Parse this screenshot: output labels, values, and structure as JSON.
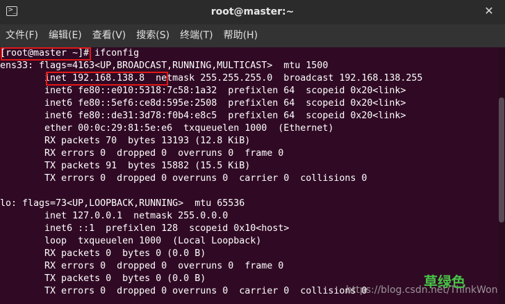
{
  "window": {
    "title": "root@master:~",
    "close_glyph": "✕"
  },
  "menu": [
    "文件(F)",
    "编辑(E)",
    "查看(V)",
    "搜索(S)",
    "终端(T)",
    "帮助(H)"
  ],
  "terminal": {
    "prompt": "[root@master ~]",
    "command": "# ifconfig",
    "lines": [
      "ens33: flags=4163<UP,BROADCAST,RUNNING,MULTICAST>  mtu 1500",
      "        inet 192.168.138.8  netmask 255.255.255.0  broadcast 192.168.138.255",
      "        inet6 fe80::e010:5318:7c58:1a32  prefixlen 64  scopeid 0x20<link>",
      "        inet6 fe80::5ef6:ce8d:595e:2508  prefixlen 64  scopeid 0x20<link>",
      "        inet6 fe80::de31:3d78:f0b4:e8c5  prefixlen 64  scopeid 0x20<link>",
      "        ether 00:0c:29:81:5e:e6  txqueuelen 1000  (Ethernet)",
      "        RX packets 70  bytes 13193 (12.8 KiB)",
      "        RX errors 0  dropped 0  overruns 0  frame 0",
      "        TX packets 91  bytes 15882 (15.5 KiB)",
      "        TX errors 0  dropped 0 overruns 0  carrier 0  collisions 0",
      "",
      "lo: flags=73<UP,LOOPBACK,RUNNING>  mtu 65536",
      "        inet 127.0.0.1  netmask 255.0.0.0",
      "        inet6 ::1  prefixlen 128  scopeid 0x10<host>",
      "        loop  txqueuelen 1000  (Local Loopback)",
      "        RX packets 0  bytes 0 (0.0 B)",
      "        RX errors 0  dropped 0  overruns 0  frame 0",
      "        TX packets 0  bytes 0 (0.0 B)",
      "        TX errors 0  dropped 0 overruns 0  carrier 0  collisions 0"
    ]
  },
  "watermark": {
    "logo": "草绿色",
    "url": "https://blog.csdn.net/ThinkWon"
  },
  "colors": {
    "terminal_bg": "#300a24",
    "highlight": "#e11818"
  }
}
